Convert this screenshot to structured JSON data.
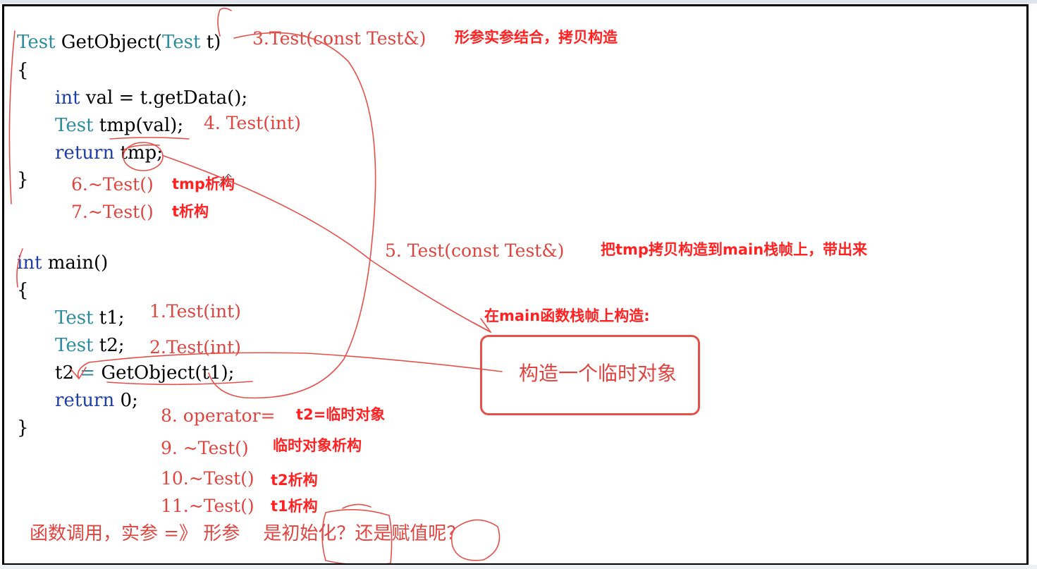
{
  "code": {
    "getobject": {
      "ret_type": "Test",
      "name": "GetObject(",
      "param_type": "Test",
      "param_name": "t)",
      "open_brace": "{",
      "line_val_kw": "int",
      "line_val_rest": "val = t.getData();",
      "line_tmp_type": "Test",
      "line_tmp_rest": "tmp(val);",
      "line_return_kw": "return",
      "line_return_rest": "tmp;",
      "close_brace": "}"
    },
    "main": {
      "ret_kw": "int",
      "name": "main()",
      "open_brace": "{",
      "t1_type": "Test",
      "t1_rest": "t1;",
      "t2_type": "Test",
      "t2_rest": "t2;",
      "assign_lhs": "t2",
      "assign_op": "=",
      "assign_rhs": "GetObject(t1);",
      "return_kw": "return",
      "return_rest": "0;",
      "close_brace": "}"
    }
  },
  "steps": {
    "s1": "1.Test(int)",
    "s2": "2.Test(int)",
    "s3": "3.Test(const Test&)",
    "s3_note": "形参实参结合，拷贝构造",
    "s4": "4. Test(int)",
    "s5": "5. Test(const Test&)",
    "s5_note": "把tmp拷贝构造到main栈帧上，带出来",
    "s6": "6.~Test()",
    "s6_note": "tmp析构",
    "s7": "7.~Test()",
    "s7_note": "t析构",
    "s8": "8. operator=",
    "s8_note": "t2=临时对象",
    "s9": "9. ~Test()",
    "s9_note": "临时对象析构",
    "s10": "10.~Test()",
    "s10_note": "t2析构",
    "s11": "11.~Test()",
    "s11_note": "t1析构"
  },
  "temp_header": "在main函数栈帧上构造:",
  "temp_box": "构造一个临时对象",
  "question": "函数调用，实参 =》 形参    是初始化？还是赋值呢？",
  "colors": {
    "annotation": "#e0443f",
    "note": "#ff2222",
    "keyword": "#1f3fa8",
    "type": "#2b8c9e"
  }
}
